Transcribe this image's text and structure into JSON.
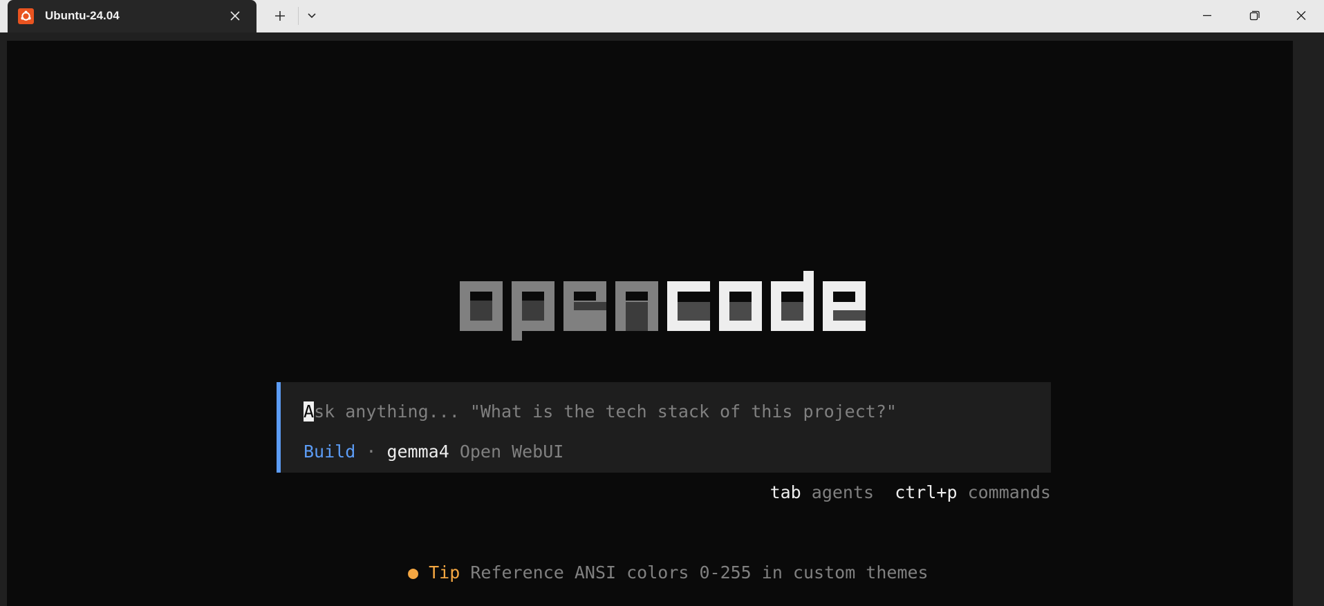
{
  "window": {
    "tab_title": "Ubuntu-24.04",
    "tab_icon": "ubuntu-icon",
    "buttons": {
      "new_tab": "plus-icon",
      "tab_menu": "chevron-down-icon",
      "minimize": "minimize-icon",
      "maximize": "restore-icon",
      "close": "close-icon"
    },
    "accent_color": "#e95420"
  },
  "terminal": {
    "logo": {
      "left_word": "open",
      "right_word": "code",
      "left_color": "#808080",
      "right_color": "#eeeeee"
    },
    "prompt": {
      "cursor_char": "A",
      "placeholder_rest": "sk anything... \"What is the tech stack of this project?\"",
      "agent": "Build",
      "separator": "·",
      "model": "gemma4",
      "provider": "Open WebUI",
      "accent_color": "#5c9cf5"
    },
    "hints": [
      {
        "key": "tab",
        "label": "agents"
      },
      {
        "key": "ctrl+p",
        "label": "commands"
      }
    ],
    "tip": {
      "bullet": "●",
      "label": "Tip",
      "text": "Reference ANSI colors 0-255 in custom themes",
      "color": "#f5a742"
    }
  }
}
